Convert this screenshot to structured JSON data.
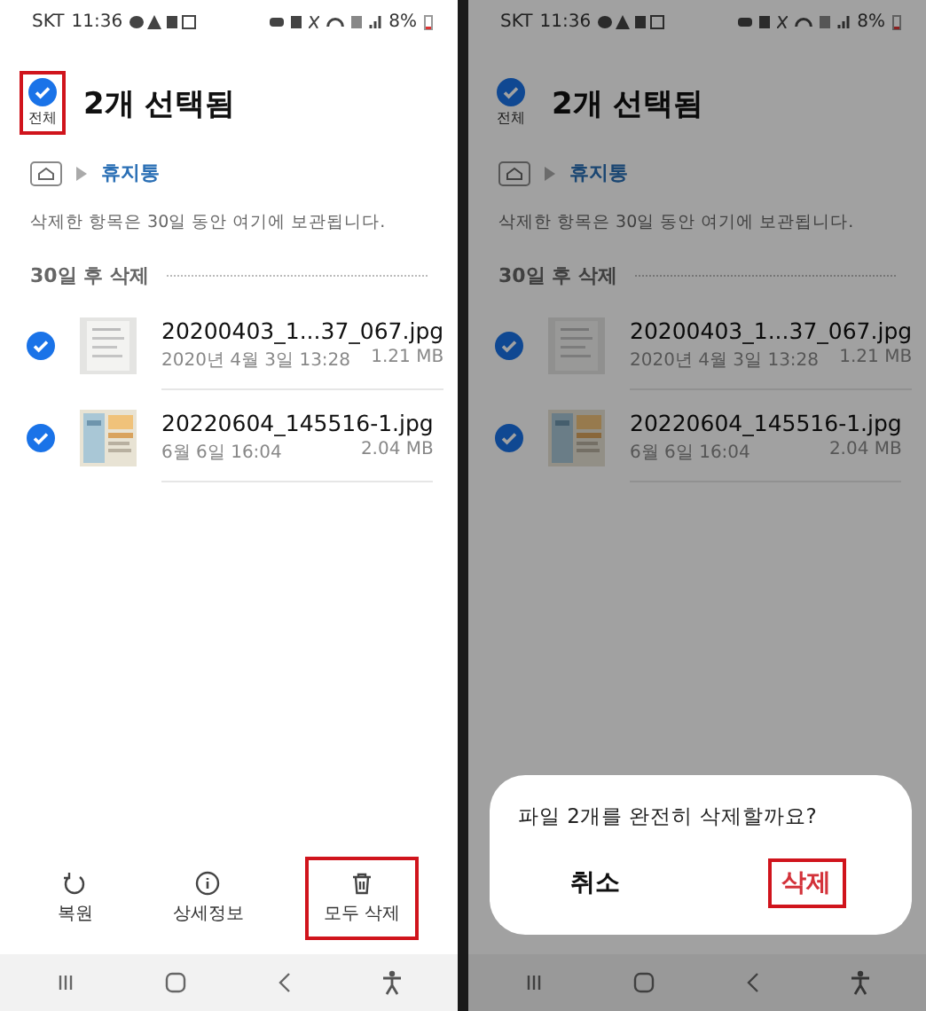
{
  "screens": [
    {
      "status_bar": {
        "carrier": "SKT",
        "time": "11:36",
        "battery": "8%"
      },
      "select_all": {
        "label": "전체",
        "checked": true,
        "highlighted": true
      },
      "title": "2개 선택됨",
      "breadcrumb": "휴지통",
      "note": "삭제한 항목은 30일 동안 여기에 보관됩니다.",
      "section": "30일 후 삭제",
      "files": [
        {
          "name": "20200403_1...37_067.jpg",
          "date": "2020년 4월 3일 13:28",
          "size": "1.21 MB",
          "checked": true
        },
        {
          "name": "20220604_145516-1.jpg",
          "date": "6월 6일 16:04",
          "size": "2.04 MB",
          "checked": true
        }
      ],
      "actions": [
        {
          "label": "복원",
          "highlighted": false
        },
        {
          "label": "상세정보",
          "highlighted": false
        },
        {
          "label": "모두 삭제",
          "highlighted": true
        }
      ]
    },
    {
      "status_bar": {
        "carrier": "SKT",
        "time": "11:36",
        "battery": "8%"
      },
      "select_all": {
        "label": "전체",
        "checked": true,
        "highlighted": false
      },
      "title": "2개 선택됨",
      "breadcrumb": "휴지통",
      "note": "삭제한 항목은 30일 동안 여기에 보관됩니다.",
      "section": "30일 후 삭제",
      "files": [
        {
          "name": "20200403_1...37_067.jpg",
          "date": "2020년 4월 3일 13:28",
          "size": "1.21 MB",
          "checked": true
        },
        {
          "name": "20220604_145516-1.jpg",
          "date": "6월 6일 16:04",
          "size": "2.04 MB",
          "checked": true
        }
      ],
      "dialog": {
        "message": "파일 2개를 완전히 삭제할까요?",
        "buttons": [
          {
            "label": "취소",
            "kind": "cancel",
            "highlighted": false
          },
          {
            "label": "삭제",
            "kind": "delete",
            "highlighted": true
          }
        ]
      }
    }
  ]
}
